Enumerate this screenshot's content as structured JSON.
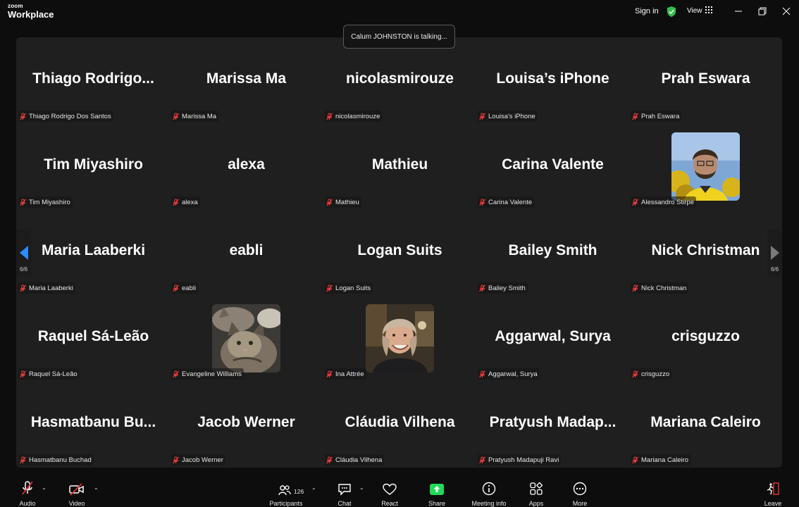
{
  "app": {
    "logo_top": "zoom",
    "logo_bottom": "Workplace"
  },
  "titlebar": {
    "signin_label": "Sign in",
    "view_label": "View"
  },
  "toast": {
    "text": "Calum JOHNSTON is talking..."
  },
  "gallery": {
    "page_indicator": "6/6",
    "tiles": [
      {
        "name": "Thiago  Rodrigo...",
        "label": "Thiago Rodrigo Dos Santos",
        "photo": null
      },
      {
        "name": "Marissa Ma",
        "label": "Marissa Ma",
        "photo": null
      },
      {
        "name": "nicolasmirouze",
        "label": "nicolasmirouze",
        "photo": null
      },
      {
        "name": "Louisa’s iPhone",
        "label": "Louisa's iPhone",
        "photo": null
      },
      {
        "name": "Prah Eswara",
        "label": "Prah Eswara",
        "photo": null
      },
      {
        "name": "Tim Miyashiro",
        "label": "Tim Miyashiro",
        "photo": null
      },
      {
        "name": "alexa",
        "label": "alexa",
        "photo": null
      },
      {
        "name": "Mathieu",
        "label": "Mathieu",
        "photo": null
      },
      {
        "name": "Carina Valente",
        "label": "Carina Valente",
        "photo": null
      },
      {
        "name": "",
        "label": "Alessandro Stirpe",
        "photo": "man-yellow-jacket"
      },
      {
        "name": "Maria Laaberki",
        "label": "Maria Laaberki",
        "photo": null
      },
      {
        "name": "eabli",
        "label": "eabli",
        "photo": null
      },
      {
        "name": "Logan Suits",
        "label": "Logan Suits",
        "photo": null
      },
      {
        "name": "Bailey Smith",
        "label": "Bailey Smith",
        "photo": null
      },
      {
        "name": "Nick Christman",
        "label": "Nick Christman",
        "photo": null
      },
      {
        "name": "Raquel Sá-Leão",
        "label": "Raquel Sá-Leão",
        "photo": null
      },
      {
        "name": "",
        "label": "Evangeline Williams",
        "photo": "cats"
      },
      {
        "name": "",
        "label": "Ina Attrée",
        "photo": "woman-smiling"
      },
      {
        "name": "Aggarwal, Surya",
        "label": "Aggarwal, Surya",
        "photo": null
      },
      {
        "name": "crisguzzo",
        "label": "crisguzzo",
        "photo": null
      },
      {
        "name": "Hasmatbanu  Bu...",
        "label": "Hasmatbanu Buchad",
        "photo": null
      },
      {
        "name": "Jacob Werner",
        "label": "Jacob Werner",
        "photo": null
      },
      {
        "name": "Cláudia Vilhena",
        "label": "Cláudia Vilhena",
        "photo": null
      },
      {
        "name": "Pratyush  Madap...",
        "label": "Pratyush Madapuji Ravi",
        "photo": null
      },
      {
        "name": "Mariana Caleiro",
        "label": "Mariana Caleiro",
        "photo": null
      }
    ]
  },
  "toolbar": {
    "audio_label": "Audio",
    "video_label": "Video",
    "participants_label": "Participants",
    "participants_count": "126",
    "chat_label": "Chat",
    "react_label": "React",
    "share_label": "Share",
    "meeting_info_label": "Meeting info",
    "apps_label": "Apps",
    "more_label": "More",
    "leave_label": "Leave"
  },
  "colors": {
    "share_green": "#23d959",
    "muted_red": "#e0302e",
    "page_blue": "#2d8cff",
    "shield_green": "#2fbf4a"
  }
}
